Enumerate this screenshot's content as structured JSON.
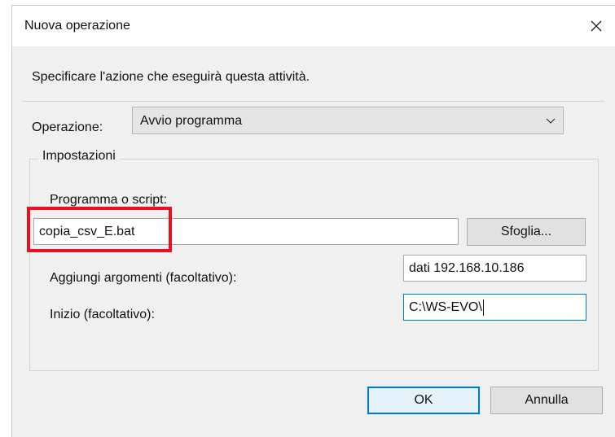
{
  "window": {
    "title": "Nuova operazione"
  },
  "description": "Specificare l'azione che eseguirà questa attività.",
  "operation": {
    "label": "Operazione:",
    "value": "Avvio programma"
  },
  "settings": {
    "group_label": "Impostazioni",
    "program": {
      "label": "Programma o script:",
      "value": "copia_csv_E.bat",
      "browse_label": "Sfoglia..."
    },
    "arguments": {
      "label": "Aggiungi argomenti (facoltativo):",
      "value": "dati 192.168.10.186"
    },
    "start_in": {
      "label": "Inizio (facoltativo):",
      "value": "C:\\WS-EVO\\"
    }
  },
  "buttons": {
    "ok": "OK",
    "cancel": "Annulla"
  },
  "icons": {
    "close": "close-icon",
    "dropdown": "chevron-down-icon"
  },
  "colors": {
    "highlight": "#e81123",
    "focus": "#0078d7"
  }
}
